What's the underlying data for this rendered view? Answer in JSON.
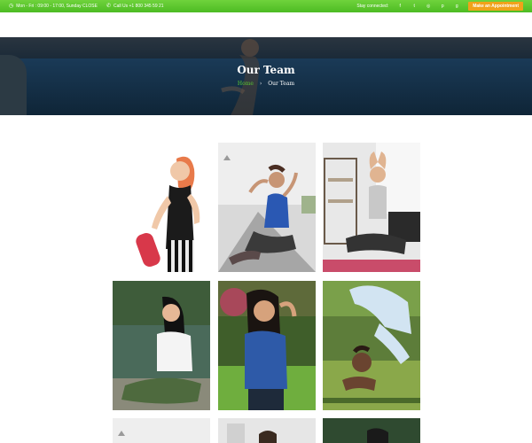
{
  "topbar": {
    "hours": "Mon - Fri : 09:00 - 17:00, Sunday CLOSE",
    "phone": "Call Us +1 800 345 59 21",
    "stay_connected": "Stay connected:",
    "social_icons": [
      "facebook-icon",
      "twitter-icon",
      "instagram-icon",
      "pinterest-icon",
      "google-plus-icon"
    ],
    "appointment_label": "Make an Appointment"
  },
  "hero": {
    "title": "Our Team",
    "breadcrumb": {
      "home": "Home",
      "separator": "›",
      "current": "Our Team"
    }
  },
  "team": [
    {
      "name": "team-member-1",
      "bg": "#ffffff"
    },
    {
      "name": "team-member-2",
      "bg": "#eeeeee"
    },
    {
      "name": "team-member-3",
      "bg": "#e8e8e8"
    },
    {
      "name": "team-member-4",
      "bg": "#2f4a34"
    },
    {
      "name": "team-member-5",
      "bg": "#3f5e2a"
    },
    {
      "name": "team-member-6",
      "bg": "#5d7d3a"
    }
  ],
  "colors": {
    "topbar_green": "#5cc52b",
    "accent_orange": "#f0a21a",
    "breadcrumb_green": "#58c532"
  }
}
